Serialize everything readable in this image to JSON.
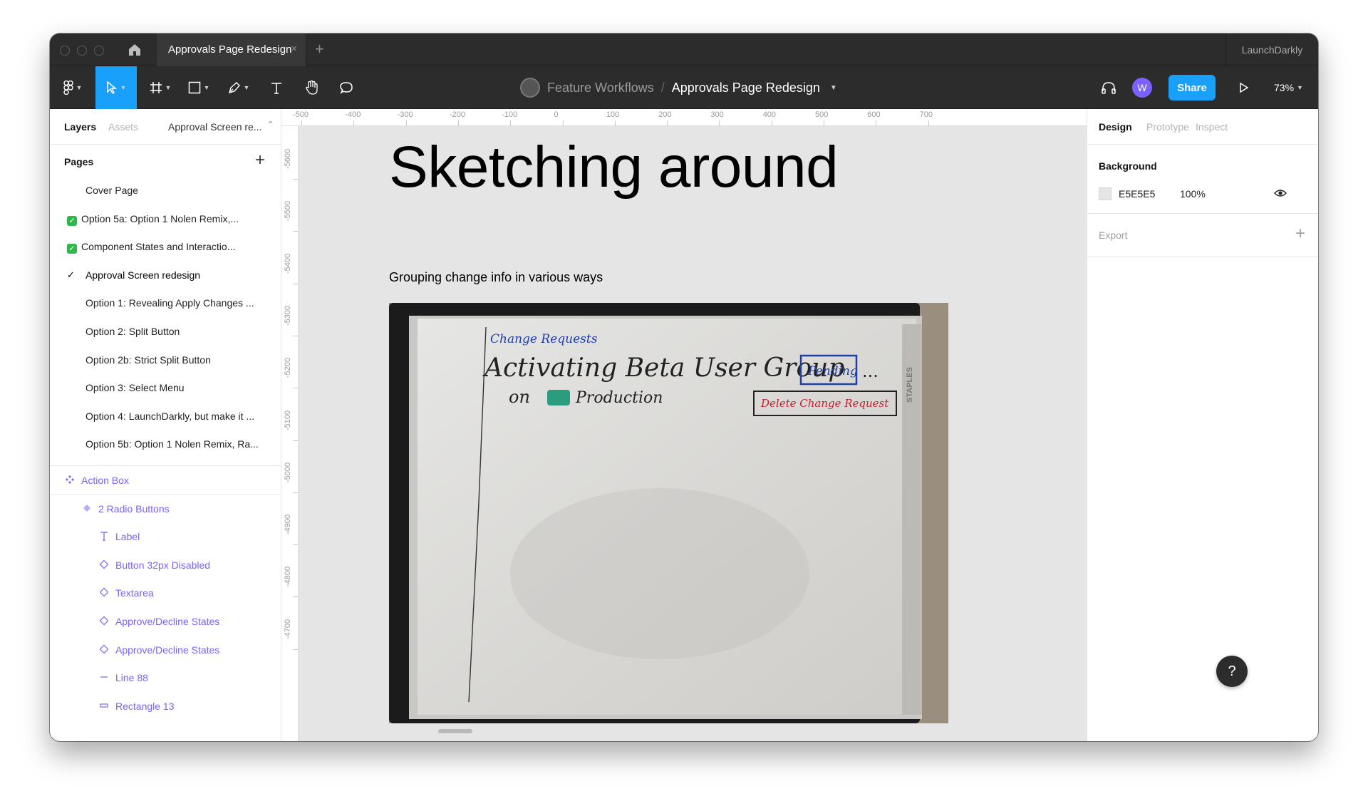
{
  "window": {
    "tab_title": "Approvals Page Redesign",
    "tab_close": "×",
    "new_tab": "+",
    "org_name": "LaunchDarkly"
  },
  "toolbar": {
    "team": "Feature Workflows",
    "separator": "/",
    "file_name": "Approvals Page Redesign",
    "avatar_initial": "W",
    "share_label": "Share",
    "zoom_level": "73%",
    "accent_color": "#18a0fb"
  },
  "left_panel": {
    "tabs": [
      "Layers",
      "Assets"
    ],
    "current_page_label": "Approval Screen re...",
    "pages_title": "Pages",
    "pages_add": "+",
    "pages": [
      {
        "label": "Cover Page",
        "prefix": "",
        "current": false
      },
      {
        "label": "Option 5a: Option 1 Nolen Remix,...",
        "prefix": "check-emoji",
        "current": false
      },
      {
        "label": "Component States and Interactio...",
        "prefix": "check-emoji",
        "current": false
      },
      {
        "label": "Approval Screen redesign",
        "prefix": "",
        "current": true
      },
      {
        "label": "Option 1: Revealing Apply Changes ...",
        "prefix": "",
        "current": false
      },
      {
        "label": "Option 2: Split Button",
        "prefix": "",
        "current": false
      },
      {
        "label": "Option 2b: Strict Split Button",
        "prefix": "",
        "current": false
      },
      {
        "label": "Option 3: Select Menu",
        "prefix": "",
        "current": false
      },
      {
        "label": "Option 4: LaunchDarkly, but make it ...",
        "prefix": "",
        "current": false
      },
      {
        "label": "Option 5b: Option 1 Nolen Remix, Ra...",
        "prefix": "",
        "current": false
      }
    ],
    "layers": [
      {
        "label": "Action Box",
        "icon": "component-icon",
        "depth": 0
      },
      {
        "label": "2 Radio Buttons",
        "icon": "instance-icon",
        "depth": 1
      },
      {
        "label": "Label",
        "icon": "text-icon",
        "depth": 2
      },
      {
        "label": "Button 32px Disabled",
        "icon": "instance-icon",
        "depth": 2
      },
      {
        "label": "Textarea",
        "icon": "instance-icon",
        "depth": 2
      },
      {
        "label": "Approve/Decline States",
        "icon": "instance-icon",
        "depth": 2
      },
      {
        "label": "Approve/Decline States",
        "icon": "instance-icon",
        "depth": 2
      },
      {
        "label": "Line 88",
        "icon": "line-icon",
        "depth": 2
      },
      {
        "label": "Rectangle 13",
        "icon": "rectangle-icon",
        "depth": 2
      }
    ],
    "layer_color": "#7b61ff"
  },
  "canvas": {
    "ruler_top": [
      "-500",
      "-400",
      "-300",
      "-200",
      "-100",
      "0",
      "100",
      "200",
      "300",
      "400",
      "500",
      "600",
      "700"
    ],
    "ruler_left": [
      "-5600",
      "-5500",
      "-5400",
      "-5300",
      "-5200",
      "-5100",
      "-5000",
      "-4900",
      "-4800",
      "-4700"
    ],
    "heading": "Sketching around",
    "subtitle": "Grouping change info in various ways",
    "whiteboard": {
      "line1": "Change Requests",
      "line2": "Activating Beta User Group",
      "badge": "Pending",
      "ellipsis": "...",
      "line3_on": "on",
      "line3_env": "Production",
      "delete_button": "Delete Change Request",
      "brand": "STAPLES"
    },
    "background_color": "#E5E5E5"
  },
  "right_panel": {
    "tabs": [
      "Design",
      "Prototype",
      "Inspect"
    ],
    "background_title": "Background",
    "background_hex": "E5E5E5",
    "background_opacity": "100%",
    "export_title": "Export",
    "export_add": "+"
  },
  "help_label": "?"
}
